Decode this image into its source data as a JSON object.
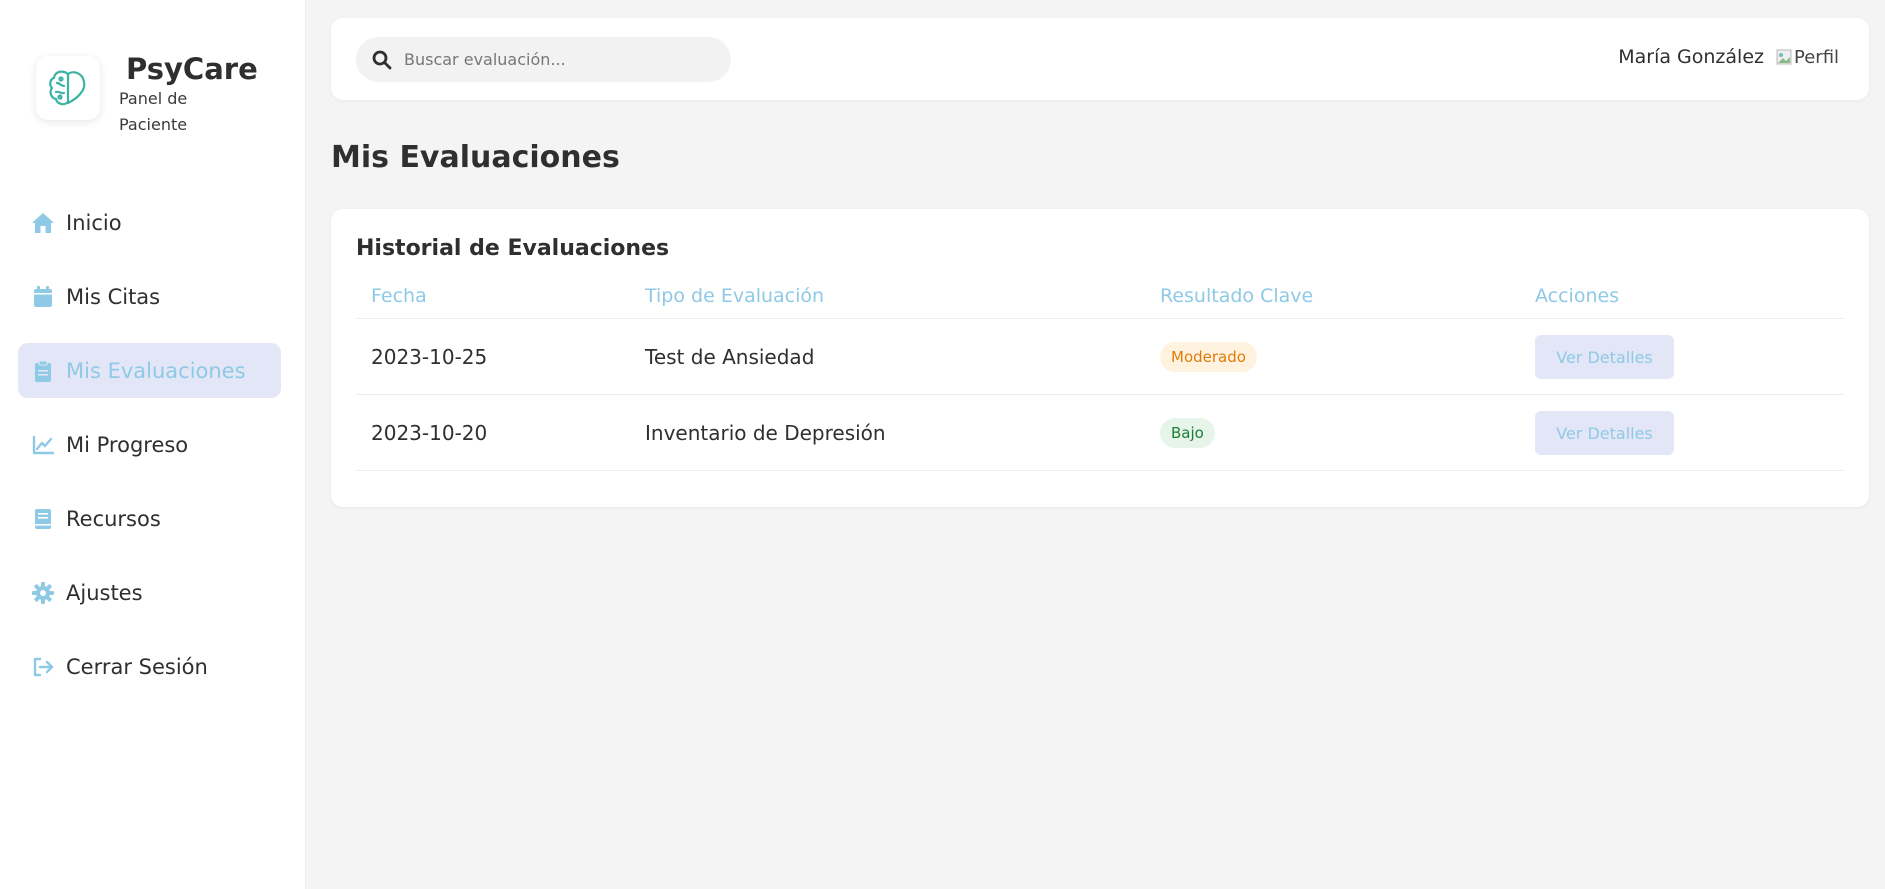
{
  "brand": {
    "name": "PsyCare",
    "subtitle": "Panel de Paciente"
  },
  "sidebar": {
    "items": [
      {
        "label": "Inicio",
        "icon": "home-icon"
      },
      {
        "label": "Mis Citas",
        "icon": "calendar-icon"
      },
      {
        "label": "Mis Evaluaciones",
        "icon": "clipboard-icon",
        "active": true
      },
      {
        "label": "Mi Progreso",
        "icon": "chart-line-icon"
      },
      {
        "label": "Recursos",
        "icon": "book-icon"
      },
      {
        "label": "Ajustes",
        "icon": "gear-icon"
      },
      {
        "label": "Cerrar Sesión",
        "icon": "logout-icon"
      }
    ]
  },
  "header": {
    "search_placeholder": "Buscar evaluación...",
    "user_name": "María González",
    "avatar_alt": "Perfil"
  },
  "main": {
    "title": "Mis Evaluaciones",
    "card_title": "Historial de Evaluaciones",
    "table": {
      "headers": [
        "Fecha",
        "Tipo de Evaluación",
        "Resultado Clave",
        "Acciones"
      ],
      "rows": [
        {
          "date": "2023-10-25",
          "type": "Test de Ansiedad",
          "result": "Moderado",
          "action": "Ver Detalles"
        },
        {
          "date": "2023-10-20",
          "type": "Inventario de Depresión",
          "result": "Bajo",
          "action": "Ver Detalles"
        }
      ]
    }
  },
  "colors": {
    "accent": "#8ec9e6",
    "active_bg": "#e3e6f6",
    "logo": "#3bb3a3",
    "badge_moderate_bg": "#fff3e0",
    "badge_moderate_text": "#e07b0a",
    "badge_low_bg": "#e6f4ea",
    "badge_low_text": "#1e7e34"
  }
}
